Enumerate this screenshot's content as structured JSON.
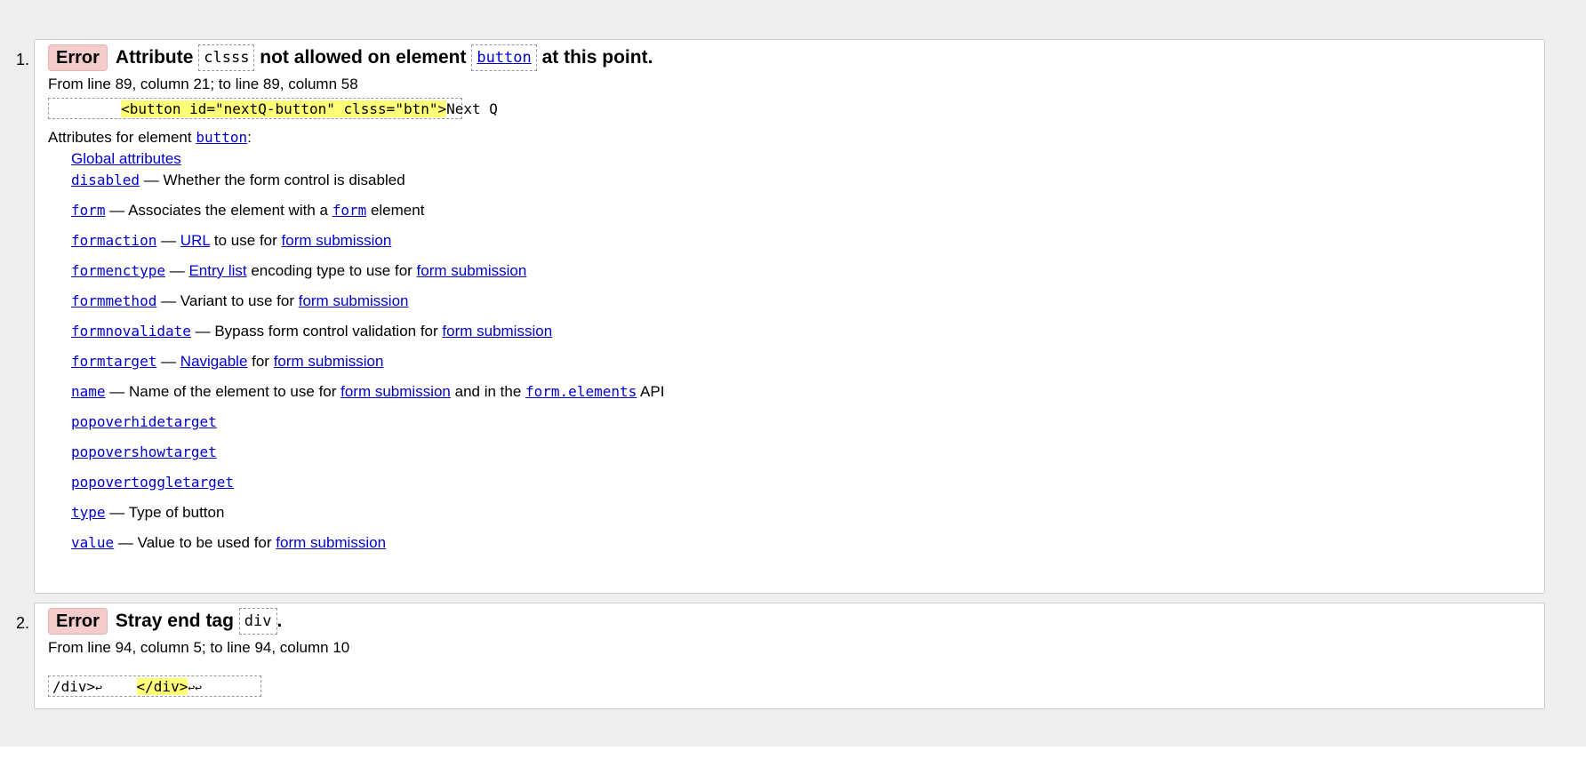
{
  "messages": [
    {
      "number": "1.",
      "badge": "Error",
      "msg_part1": "Attribute",
      "code1": "clsss",
      "msg_part2": "not allowed on element",
      "code2": "button",
      "msg_part3": "at this point.",
      "location": "From line 89, column 21; to line 89, column 58",
      "extract_pre": "        ",
      "extract_highlight": "<button id=\"nextQ-button\" clsss=\"btn\">",
      "extract_post": "Next Q",
      "attrs_intro": "Attributes for element",
      "attrs_element": "button",
      "attrs_colon": ":",
      "global_attributes": "Global attributes",
      "attributes": [
        {
          "name": "disabled",
          "dash": "—",
          "desc": [
            {
              "t": "Whether the form control is disabled"
            }
          ]
        },
        {
          "name": "form",
          "dash": "—",
          "desc": [
            {
              "t": "Associates the element with a "
            },
            {
              "t": "form",
              "link": true,
              "mono": true
            },
            {
              "t": " element"
            }
          ]
        },
        {
          "name": "formaction",
          "dash": "—",
          "desc": [
            {
              "t": "URL",
              "link": true
            },
            {
              "t": " to use for "
            },
            {
              "t": "form submission",
              "link": true
            }
          ]
        },
        {
          "name": "formenctype",
          "dash": "—",
          "desc": [
            {
              "t": "Entry list",
              "link": true
            },
            {
              "t": " encoding type to use for "
            },
            {
              "t": "form submission",
              "link": true
            }
          ]
        },
        {
          "name": "formmethod",
          "dash": "—",
          "desc": [
            {
              "t": "Variant to use for "
            },
            {
              "t": "form submission",
              "link": true
            }
          ]
        },
        {
          "name": "formnovalidate",
          "dash": "—",
          "desc": [
            {
              "t": "Bypass form control validation for "
            },
            {
              "t": "form submission",
              "link": true
            }
          ]
        },
        {
          "name": "formtarget",
          "dash": "—",
          "desc": [
            {
              "t": "Navigable",
              "link": true
            },
            {
              "t": " for "
            },
            {
              "t": "form submission",
              "link": true
            }
          ]
        },
        {
          "name": "name",
          "dash": "—",
          "desc": [
            {
              "t": "Name of the element to use for "
            },
            {
              "t": "form submission",
              "link": true
            },
            {
              "t": " and in the "
            },
            {
              "t": "form.elements",
              "link": true,
              "mono": true
            },
            {
              "t": " API"
            }
          ]
        },
        {
          "name": "popoverhidetarget",
          "dash": "",
          "desc": []
        },
        {
          "name": "popovershowtarget",
          "dash": "",
          "desc": []
        },
        {
          "name": "popovertoggletarget",
          "dash": "",
          "desc": []
        },
        {
          "name": "type",
          "dash": "—",
          "desc": [
            {
              "t": "Type of button"
            }
          ]
        },
        {
          "name": "value",
          "dash": "—",
          "desc": [
            {
              "t": "Value to be used for "
            },
            {
              "t": "form submission",
              "link": true
            }
          ]
        }
      ]
    },
    {
      "number": "2.",
      "badge": "Error",
      "msg_part1": "Stray end tag",
      "code1": "div",
      "msg_part2": ".",
      "location": "From line 94, column 5; to line 94, column 10",
      "extract_pre": "/div>",
      "extract_ret1": "↩",
      "extract_mid": "    ",
      "extract_highlight": "</div>",
      "extract_ret2": "↩↩"
    }
  ],
  "colors": {
    "page_background": "#eeeeee",
    "error_badge_background": "#f5cccc",
    "link": "#0000cc",
    "highlight": "#ffff77"
  }
}
